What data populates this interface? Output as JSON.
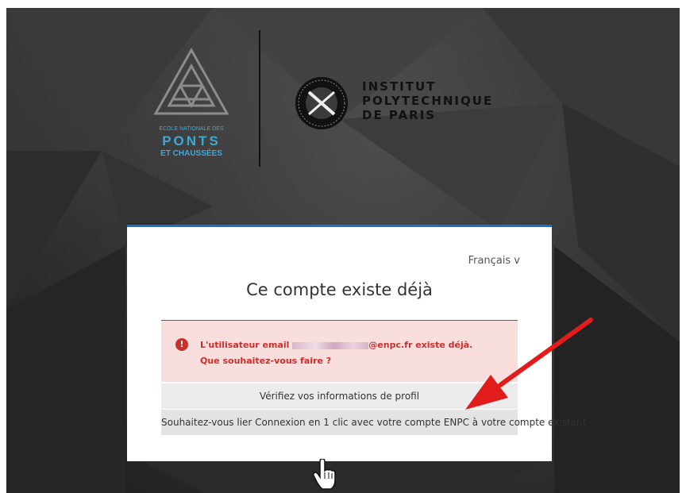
{
  "logos": {
    "enpc": {
      "small": "ÉCOLE NATIONALE DES",
      "big": "PONTS",
      "sub": "ET CHAUSSÉES"
    },
    "ipp": {
      "line1": "INSTITUT",
      "line2": "POLYTECHNIQUE",
      "line3": "DE PARIS"
    }
  },
  "card": {
    "language": "Français v",
    "title": "Ce compte existe déjà",
    "alert": {
      "icon": "exclamation-icon",
      "prefix": "L'utilisateur email",
      "suffix": "@enpc.fr existe déjà.",
      "question": "Que souhaitez-vous faire ?"
    },
    "options": {
      "review": "Vérifiez vos informations de profil",
      "link": "Souhaitez-vous lier Connexion en 1 clic avec votre compte ENPC à votre compte existant"
    }
  },
  "colors": {
    "accent": "#1a72c8",
    "error": "#c9302c",
    "arrow": "#e21b1b",
    "enpc": "#3fa9d6"
  }
}
